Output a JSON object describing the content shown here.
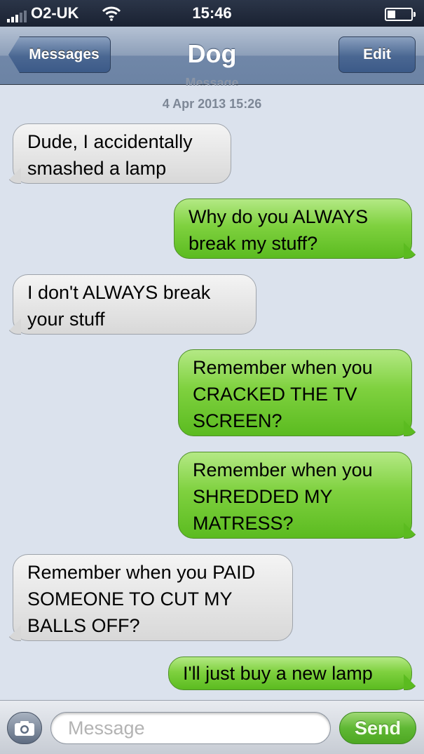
{
  "status_bar": {
    "carrier": "O2-UK",
    "time": "15:46"
  },
  "nav": {
    "back_label": "Messages",
    "title": "Dog",
    "edit_label": "Edit"
  },
  "thread": {
    "ghost_label": "Message",
    "timestamp": "4 Apr 2013 15:26",
    "messages": [
      {
        "direction": "in",
        "text": "Dude, I accidentally\nsmashed a lamp"
      },
      {
        "direction": "out",
        "text": "Why do you ALWAYS\nbreak my stuff?"
      },
      {
        "direction": "in",
        "text": "I don't ALWAYS break\nyour stuff"
      },
      {
        "direction": "out",
        "text": "Remember when you\nCRACKED THE TV\nSCREEN?"
      },
      {
        "direction": "out",
        "text": "Remember when you\nSHREDDED MY\nMATRESS?"
      },
      {
        "direction": "in",
        "text": "Remember when you PAID\nSOMEONE TO CUT MY\nBALLS OFF?"
      },
      {
        "direction": "out",
        "text": "I'll just buy a new lamp"
      }
    ]
  },
  "composer": {
    "placeholder": "Message",
    "value": "",
    "send_label": "Send"
  },
  "colors": {
    "incoming_bubble": "#e6e6e6",
    "outgoing_bubble": "#7fd13f",
    "background": "#dbe2ed"
  }
}
